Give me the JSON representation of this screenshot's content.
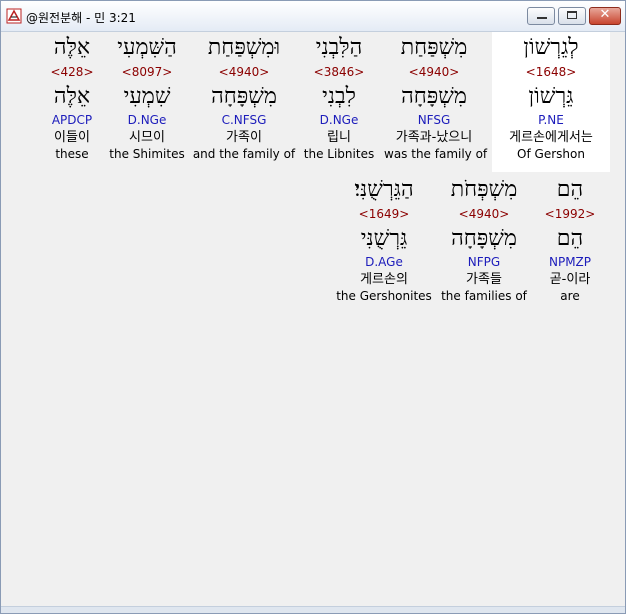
{
  "window": {
    "title": "@원전분해 - 민 3:21",
    "icon": "hebrew-tool-icon",
    "minimize_label": "minimize",
    "maximize_label": "maximize",
    "close_glyph": "✕"
  },
  "rows": [
    {
      "words": [
        {
          "hebrew": "לְגֵרְשׁוֹן",
          "strong": "<1648>",
          "lemma": "גֵּרְשׁוֹן",
          "parse": "P.NE",
          "korean": "게르손에게서는",
          "english": "Of Gershon",
          "highlight": true
        },
        {
          "hebrew": "מִשְׁפַּחַת",
          "strong": "<4940>",
          "lemma": "מִשְׁפָּחָה",
          "parse": "NFSG",
          "korean": "가족과-났으니",
          "english": "was the family of",
          "highlight": false
        },
        {
          "hebrew": "הַלִּבְנִי",
          "strong": "<3846>",
          "lemma": "לִבְנִי",
          "parse": "D.NGe",
          "korean": "립니",
          "english": "the Libnites",
          "highlight": false
        },
        {
          "hebrew": "וּמִשְׁפַּחַת",
          "strong": "<4940>",
          "lemma": "מִשְׁפָּחָה",
          "parse": "C.NFSG",
          "korean": "가족이",
          "english": "and the family of",
          "highlight": false
        },
        {
          "hebrew": "הַשִּׁמְעִי",
          "strong": "<8097>",
          "lemma": "שִׁמְעִי",
          "parse": "D.NGe",
          "korean": "시므이",
          "english": "the Shimites",
          "highlight": false
        },
        {
          "hebrew": "אֵלֶּה",
          "strong": "<428>",
          "lemma": "אֵלֶּה",
          "parse": "APDCP",
          "korean": "이들이",
          "english": "these",
          "highlight": false
        }
      ]
    },
    {
      "words": [
        {
          "hebrew": "הֵם",
          "strong": "<1992>",
          "lemma": "הֵם",
          "parse": "NPMZP",
          "korean": "곧-이라",
          "english": "are",
          "highlight": false
        },
        {
          "hebrew": "מִשְׁפְּחֹת",
          "strong": "<4940>",
          "lemma": "מִשְׁפָּחָה",
          "parse": "NFPG",
          "korean": "가족들",
          "english": "the families of",
          "highlight": false
        },
        {
          "hebrew": "הַגֵּרְשֻׁנִּי׃",
          "strong": "<1649>",
          "lemma": "גֵּרְשֻׁנִּי",
          "parse": "D.AGe",
          "korean": "게르손의",
          "english": "the Gershonites",
          "highlight": false
        }
      ]
    }
  ]
}
